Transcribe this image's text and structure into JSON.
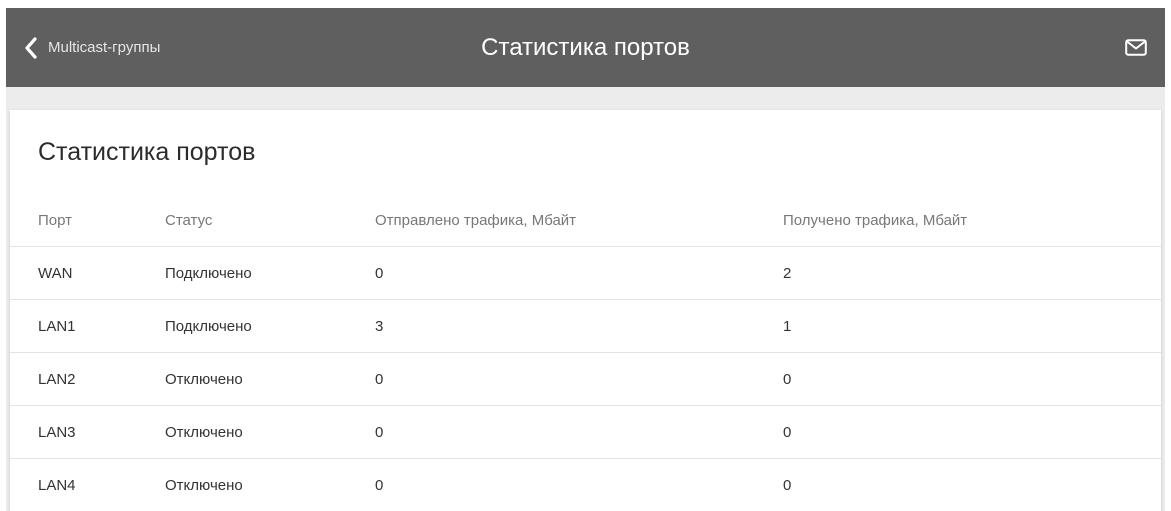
{
  "header": {
    "back_label": "Multicast-группы",
    "title": "Статистика портов"
  },
  "card": {
    "title": "Статистика портов"
  },
  "table": {
    "columns": [
      "Порт",
      "Статус",
      "Отправлено трафика, Мбайт",
      "Получено трафика, Мбайт"
    ],
    "rows": [
      [
        "WAN",
        "Подключено",
        "0",
        "2"
      ],
      [
        "LAN1",
        "Подключено",
        "3",
        "1"
      ],
      [
        "LAN2",
        "Отключено",
        "0",
        "0"
      ],
      [
        "LAN3",
        "Отключено",
        "0",
        "0"
      ],
      [
        "LAN4",
        "Отключено",
        "0",
        "0"
      ]
    ]
  },
  "colors": {
    "topbar": "#5f5f5f",
    "background": "#ececec",
    "card": "#ffffff"
  },
  "icons": {
    "back": "chevron-left-icon",
    "mail": "envelope-icon"
  }
}
